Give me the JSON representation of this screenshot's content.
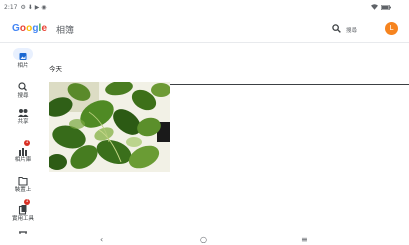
{
  "status_bar": {
    "time": "2:17",
    "icons_left": "⚙ ⬇ ▶ ◉",
    "battery": "battery-icon",
    "wifi": "wifi-icon"
  },
  "header": {
    "logo_text": "Google",
    "app_name": "相簿",
    "search_label": "搜尋",
    "avatar_initial": "L",
    "avatar_color": "#f6841f"
  },
  "sidebar": {
    "items": [
      {
        "label": "相片",
        "icon": "photos-icon",
        "active": true
      },
      {
        "label": "搜尋",
        "icon": "search-icon"
      },
      {
        "label": "共享",
        "icon": "sharing-icon"
      },
      {
        "label": "相片庫",
        "icon": "library-icon",
        "badge": "1"
      },
      {
        "label": "裝置上",
        "icon": "folder-icon"
      },
      {
        "label": "實用工具",
        "icon": "utilities-icon",
        "badge": "1"
      }
    ]
  },
  "main": {
    "section_label": "今天"
  },
  "nav_bar": {
    "back": "‹",
    "home": "○",
    "recents": "≡"
  },
  "colors": {
    "accent": "#1a73e8",
    "badge": "#d93025",
    "leaf": "#3c7a1e"
  }
}
